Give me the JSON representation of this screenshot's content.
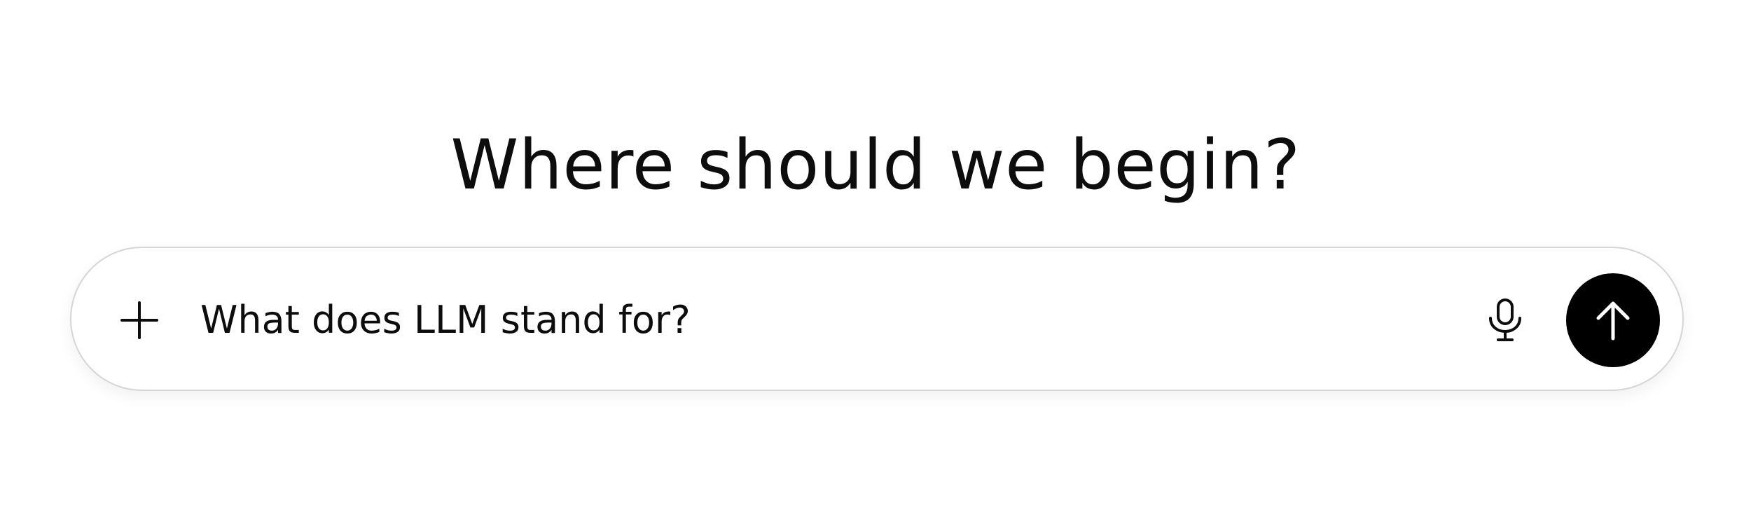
{
  "page": {
    "headline": "Where should we begin?"
  },
  "composer": {
    "input_value": "What does LLM stand for?",
    "plus_icon": "plus-icon",
    "mic_icon": "microphone-icon",
    "send_icon": "arrow-up-icon"
  },
  "colors": {
    "text": "#0d0d0d",
    "border": "#d6d6d6",
    "send_button": "#000000",
    "send_icon": "#ffffff",
    "background": "#ffffff"
  }
}
